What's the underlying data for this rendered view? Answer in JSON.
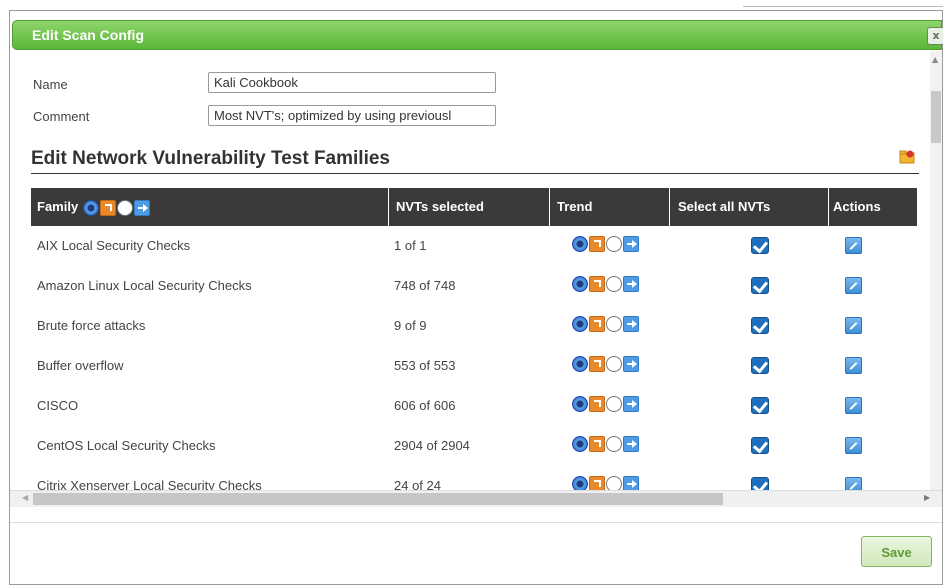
{
  "dialog": {
    "title": "Edit Scan Config",
    "close_label": "x",
    "save_label": "Save"
  },
  "form": {
    "name_label": "Name",
    "name_value": "Kali Cookbook",
    "comment_label": "Comment",
    "comment_value": "Most NVT's; optimized by using previousl"
  },
  "section": {
    "title": "Edit Network Vulnerability Test Families"
  },
  "table": {
    "headers": {
      "family": "Family",
      "nvts_selected": "NVTs selected",
      "trend": "Trend",
      "select_all": "Select all NVTs",
      "actions": "Actions"
    },
    "rows": [
      {
        "family": "AIX Local Security Checks",
        "nvts": "1 of 1"
      },
      {
        "family": "Amazon Linux Local Security Checks",
        "nvts": "748 of 748"
      },
      {
        "family": "Brute force attacks",
        "nvts": "9 of 9"
      },
      {
        "family": "Buffer overflow",
        "nvts": "553 of 553"
      },
      {
        "family": "CISCO",
        "nvts": "606 of 606"
      },
      {
        "family": "CentOS Local Security Checks",
        "nvts": "2904 of 2904"
      },
      {
        "family": "Citrix Xenserver Local Security Checks",
        "nvts": "24 of 24"
      }
    ]
  },
  "icons": {
    "trend_selected": "radio-selected-icon",
    "trend_up": "trend-up-icon",
    "trend_unselected": "radio-unselected-icon",
    "trend_same": "trend-arrow-icon",
    "select_all": "checkbox-checked-icon",
    "action": "edit-wrench-icon",
    "folder": "folder-export-icon"
  },
  "colors": {
    "titlebar": "#6cc24a",
    "table_header": "#3a3a3a",
    "save_text": "#5e9a36"
  }
}
